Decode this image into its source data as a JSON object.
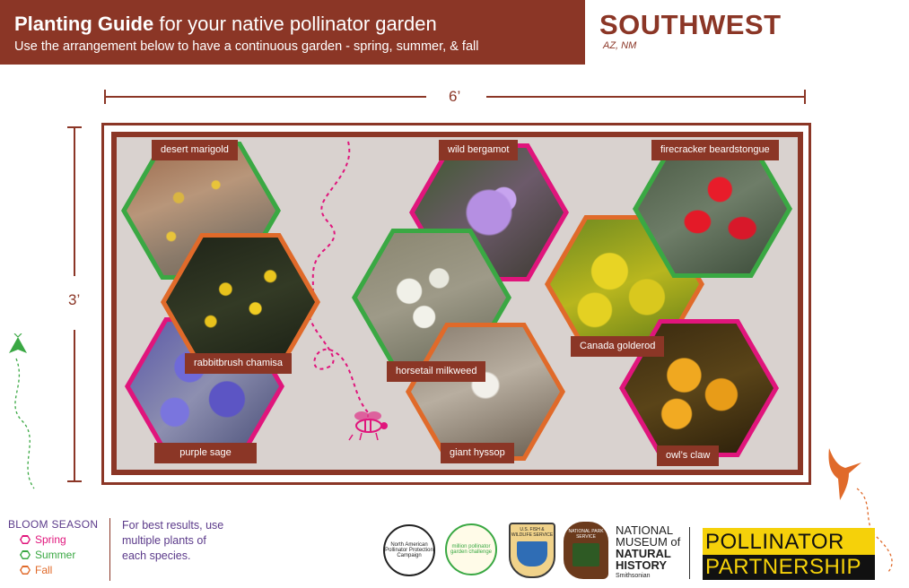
{
  "header": {
    "title_bold": "Planting Guide",
    "title_rest": " for your native pollinator garden",
    "subtitle": "Use the arrangement below to have a continuous garden - spring, summer, & fall",
    "region": "SOUTHWEST",
    "states": "AZ, NM"
  },
  "dimensions": {
    "width": "6’",
    "height": "3’"
  },
  "plants": [
    {
      "name": "desert marigold",
      "season": "Summer"
    },
    {
      "name": "rabbitbrush chamisa",
      "season": "Fall"
    },
    {
      "name": "purple sage",
      "season": "Spring"
    },
    {
      "name": "wild bergamot",
      "season": "Spring"
    },
    {
      "name": "horsetail milkweed",
      "season": "Summer"
    },
    {
      "name": "giant hyssop",
      "season": "Fall"
    },
    {
      "name": "firecracker beardstongue",
      "season": "Summer"
    },
    {
      "name": "Canada golderod",
      "season": "Fall"
    },
    {
      "name": "owl’s claw",
      "season": "Spring"
    }
  ],
  "legend": {
    "title": "BLOOM SEASON",
    "items": [
      {
        "label": "Spring",
        "color": "#e0157c"
      },
      {
        "label": "Summer",
        "color": "#3aa843"
      },
      {
        "label": "Fall",
        "color": "#e06a2a"
      }
    ]
  },
  "tip": "For best results, use multiple plants of each species.",
  "logos": {
    "nappc": "North American Pollinator Protection Campaign",
    "mpgc": "million pollinator garden challenge",
    "usfws": "U.S. FISH & WILDLIFE SERVICE",
    "nps": "NATIONAL PARK SERVICE",
    "nmnh_line1": "NATIONAL",
    "nmnh_line2": "MUSEUM of",
    "nmnh_line3": "NATURAL",
    "nmnh_line4": "HISTORY",
    "nmnh_line5": "Smithsonian",
    "pp_line1": "POLLINATOR",
    "pp_line2": "PARTNERSHIP"
  },
  "colors": {
    "brown": "#8b3626",
    "spring": "#e0157c",
    "summer": "#3aa843",
    "fall": "#e06a2a",
    "garden_bg": "#d9d2cf",
    "partnership_yellow": "#f5d10a"
  }
}
